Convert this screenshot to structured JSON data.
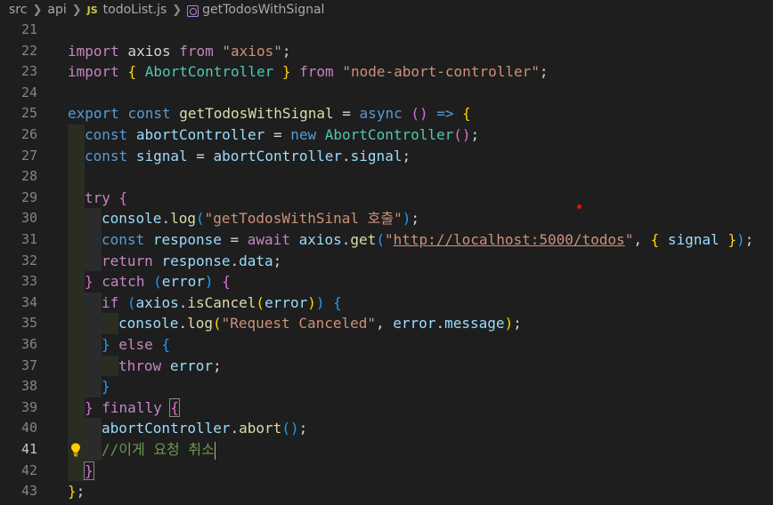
{
  "breadcrumb": {
    "items": [
      "src",
      "api",
      "todoList.js",
      "getTodosWithSignal"
    ],
    "file_badge": "JS"
  },
  "editor": {
    "active_line": 41,
    "lines": [
      {
        "n": "21"
      },
      {
        "n": "22",
        "t": [
          "import",
          " axios ",
          "from",
          " ",
          "\"axios\"",
          ";"
        ]
      },
      {
        "n": "23",
        "t": [
          "import",
          " ",
          "{",
          " ",
          "AbortController",
          " ",
          "}",
          " ",
          "from",
          " ",
          "\"node-abort-controller\"",
          ";"
        ]
      },
      {
        "n": "24"
      },
      {
        "n": "25",
        "t": [
          "export",
          " ",
          "const",
          " ",
          "getTodosWithSignal",
          " = ",
          "async",
          " ",
          "()",
          " ",
          "=>",
          " ",
          "{"
        ]
      },
      {
        "n": "26",
        "t": [
          "const",
          " ",
          "abortController",
          " = ",
          "new",
          " ",
          "AbortController",
          "()",
          ";"
        ]
      },
      {
        "n": "27",
        "t": [
          "const",
          " ",
          "signal",
          " = ",
          "abortController",
          ".",
          "signal",
          ";"
        ]
      },
      {
        "n": "28"
      },
      {
        "n": "29",
        "t": [
          "try",
          " ",
          "{"
        ]
      },
      {
        "n": "30",
        "t": [
          "console",
          ".",
          "log",
          "(",
          "\"getTodosWithSinal 호출\"",
          ")",
          ";"
        ]
      },
      {
        "n": "31",
        "t": [
          "const",
          " ",
          "response",
          " = ",
          "await",
          " ",
          "axios",
          ".",
          "get",
          "(",
          "\"",
          "http://localhost:5000/todos",
          "\"",
          ", ",
          "{",
          " ",
          "signal",
          " ",
          "}",
          ")",
          ";"
        ]
      },
      {
        "n": "32",
        "t": [
          "return",
          " ",
          "response",
          ".",
          "data",
          ";"
        ]
      },
      {
        "n": "33",
        "t": [
          "}",
          " ",
          "catch",
          " ",
          "(",
          "error",
          ")",
          " ",
          "{"
        ]
      },
      {
        "n": "34",
        "t": [
          "if",
          " ",
          "(",
          "axios",
          ".",
          "isCancel",
          "(",
          "error",
          ")",
          ")",
          " ",
          "{"
        ]
      },
      {
        "n": "35",
        "t": [
          "console",
          ".",
          "log",
          "(",
          "\"Request Canceled\"",
          ", ",
          "error",
          ".",
          "message",
          ")",
          ";"
        ]
      },
      {
        "n": "36",
        "t": [
          "}",
          " ",
          "else",
          " ",
          "{"
        ]
      },
      {
        "n": "37",
        "t": [
          "throw",
          " ",
          "error",
          ";"
        ]
      },
      {
        "n": "38",
        "t": [
          "}"
        ]
      },
      {
        "n": "39",
        "t": [
          "}",
          " ",
          "finally",
          " ",
          "{"
        ]
      },
      {
        "n": "40",
        "t": [
          "abortController",
          ".",
          "abort",
          "()",
          ";"
        ]
      },
      {
        "n": "41",
        "t": [
          "//이게 요청 취소"
        ]
      },
      {
        "n": "42",
        "t": [
          "}"
        ]
      },
      {
        "n": "43",
        "t": [
          "}",
          ";"
        ]
      }
    ]
  },
  "colors": {
    "background": "#1e1e1e",
    "keyword": "#c586c0",
    "storage": "#569cd6",
    "function": "#dcdcaa",
    "class": "#4ec9b0",
    "variable": "#9cdcfe",
    "string": "#ce9178",
    "comment": "#6a9955"
  },
  "icons": {
    "lightbulb": "lightbulb-icon",
    "symbol": "method-symbol-icon"
  }
}
